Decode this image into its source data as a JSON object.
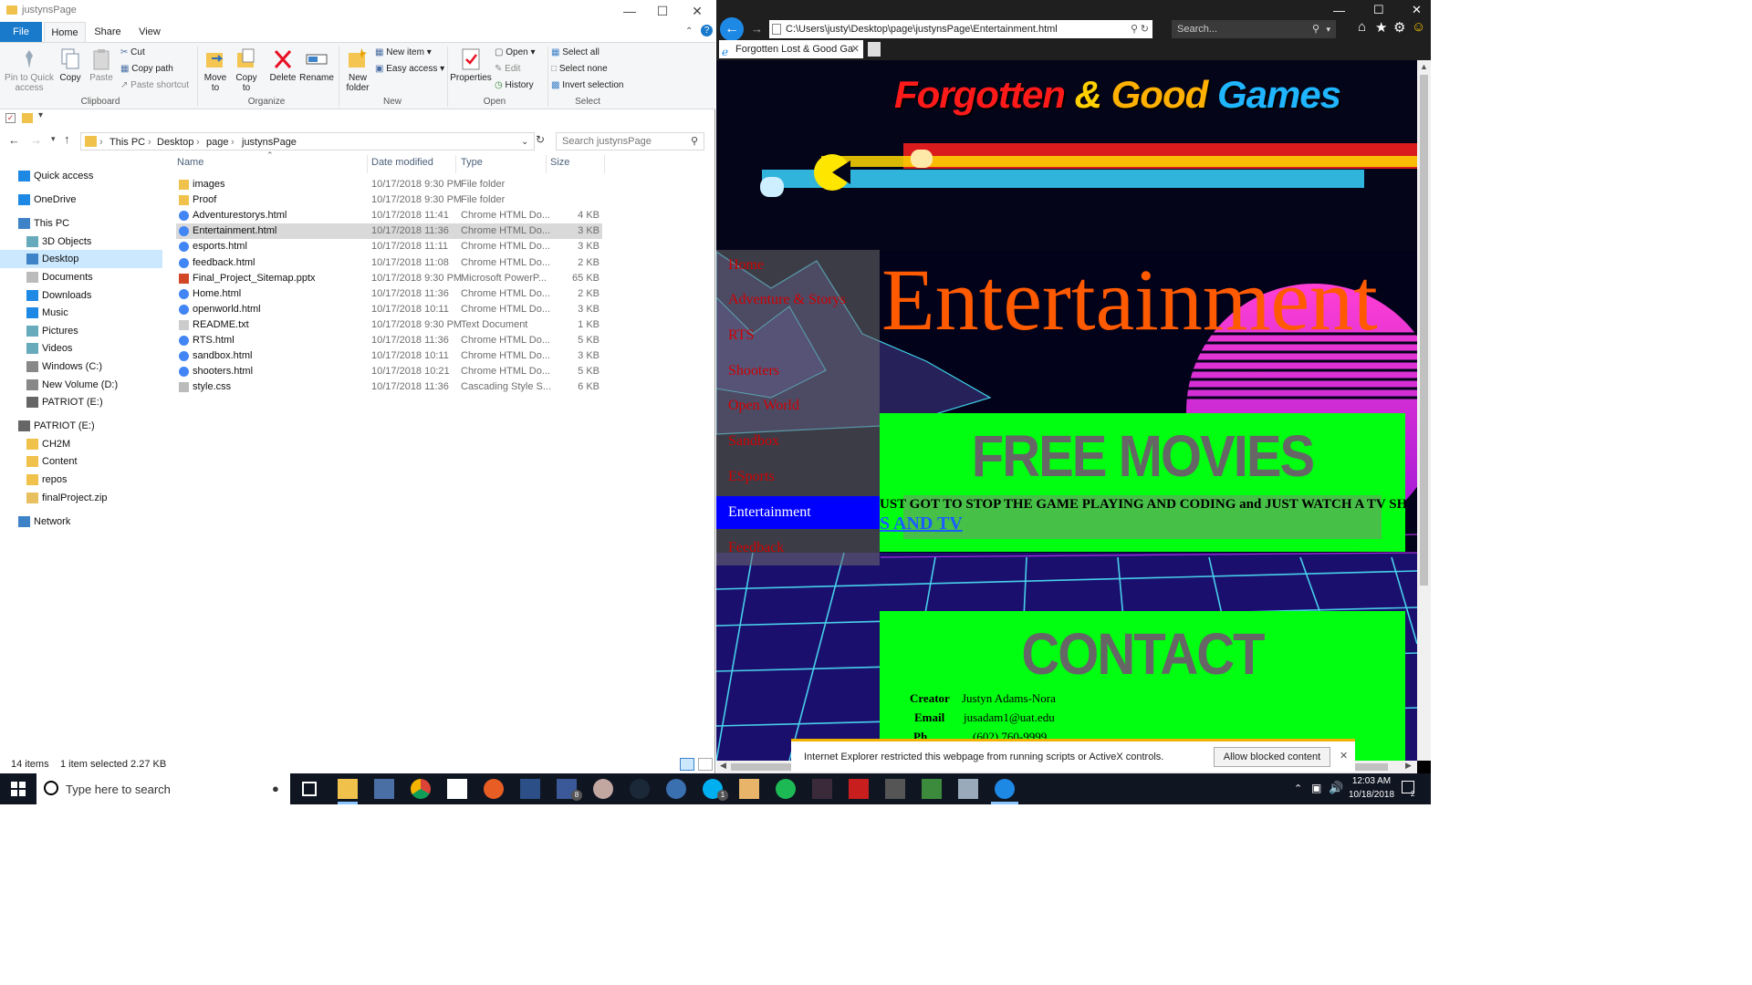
{
  "explorer": {
    "title": "justynsPage",
    "tabs": [
      "File",
      "Home",
      "Share",
      "View"
    ],
    "ribbon": {
      "clipboard": {
        "pin": "Pin to Quick access",
        "copy": "Copy",
        "paste": "Paste",
        "cut": "Cut",
        "copy_path": "Copy path",
        "paste_shortcut": "Paste shortcut",
        "group": "Clipboard"
      },
      "organize": {
        "move": "Move to",
        "copy": "Copy to",
        "delete": "Delete",
        "rename": "Rename",
        "group": "Organize"
      },
      "new": {
        "new_folder": "New folder",
        "new_item": "New item",
        "easy_access": "Easy access",
        "group": "New"
      },
      "open": {
        "properties": "Properties",
        "open": "Open",
        "edit": "Edit",
        "history": "History",
        "group": "Open"
      },
      "select": {
        "select_all": "Select all",
        "select_none": "Select none",
        "invert": "Invert selection",
        "group": "Select"
      }
    },
    "breadcrumb": [
      "This PC",
      "Desktop",
      "page",
      "justynsPage"
    ],
    "search_placeholder": "Search justynsPage",
    "nav": [
      {
        "label": "Quick access",
        "icon": "star-icon",
        "level": 0
      },
      {
        "label": "OneDrive",
        "icon": "cloud-icon",
        "level": 0
      },
      {
        "label": "This PC",
        "icon": "computer-icon",
        "level": 0
      },
      {
        "label": "3D Objects",
        "icon": "cube-icon",
        "level": 1
      },
      {
        "label": "Desktop",
        "icon": "desktop-icon",
        "level": 1,
        "selected": true
      },
      {
        "label": "Documents",
        "icon": "document-icon",
        "level": 1
      },
      {
        "label": "Downloads",
        "icon": "download-icon",
        "level": 1
      },
      {
        "label": "Music",
        "icon": "music-icon",
        "level": 1
      },
      {
        "label": "Pictures",
        "icon": "pictures-icon",
        "level": 1
      },
      {
        "label": "Videos",
        "icon": "video-icon",
        "level": 1
      },
      {
        "label": "Windows (C:)",
        "icon": "drive-icon",
        "level": 1
      },
      {
        "label": "New Volume (D:)",
        "icon": "drive-icon",
        "level": 1
      },
      {
        "label": "PATRIOT (E:)",
        "icon": "usb-drive-icon",
        "level": 1
      },
      {
        "label": "PATRIOT (E:)",
        "icon": "usb-drive-icon",
        "level": 0
      },
      {
        "label": "CH2M",
        "icon": "folder-icon",
        "level": 1
      },
      {
        "label": "Content",
        "icon": "folder-icon",
        "level": 1
      },
      {
        "label": "repos",
        "icon": "folder-icon",
        "level": 1
      },
      {
        "label": "finalProject.zip",
        "icon": "zip-icon",
        "level": 1
      },
      {
        "label": "Network",
        "icon": "network-icon",
        "level": 0
      }
    ],
    "columns": [
      "Name",
      "Date modified",
      "Type",
      "Size"
    ],
    "files": [
      {
        "name": "images",
        "date": "10/17/2018 9:30 PM",
        "type": "File folder",
        "size": "",
        "icon": "folder-icon"
      },
      {
        "name": "Proof",
        "date": "10/17/2018 9:30 PM",
        "type": "File folder",
        "size": "",
        "icon": "folder-icon"
      },
      {
        "name": "Adventurestorys.html",
        "date": "10/17/2018 11:41",
        "type": "Chrome HTML Do...",
        "size": "4 KB",
        "icon": "chrome-icon"
      },
      {
        "name": "Entertainment.html",
        "date": "10/17/2018 11:36",
        "type": "Chrome HTML Do...",
        "size": "3 KB",
        "icon": "chrome-icon",
        "selected": true
      },
      {
        "name": "esports.html",
        "date": "10/17/2018 11:11",
        "type": "Chrome HTML Do...",
        "size": "3 KB",
        "icon": "chrome-icon"
      },
      {
        "name": "feedback.html",
        "date": "10/17/2018 11:08",
        "type": "Chrome HTML Do...",
        "size": "2 KB",
        "icon": "chrome-icon"
      },
      {
        "name": "Final_Project_Sitemap.pptx",
        "date": "10/17/2018 9:30 PM",
        "type": "Microsoft PowerP...",
        "size": "65 KB",
        "icon": "powerpoint-icon"
      },
      {
        "name": "Home.html",
        "date": "10/17/2018 11:36",
        "type": "Chrome HTML Do...",
        "size": "2 KB",
        "icon": "chrome-icon"
      },
      {
        "name": "openworld.html",
        "date": "10/17/2018 10:11",
        "type": "Chrome HTML Do...",
        "size": "3 KB",
        "icon": "chrome-icon"
      },
      {
        "name": "README.txt",
        "date": "10/17/2018 9:30 PM",
        "type": "Text Document",
        "size": "1 KB",
        "icon": "text-file-icon"
      },
      {
        "name": "RTS.html",
        "date": "10/17/2018 11:36",
        "type": "Chrome HTML Do...",
        "size": "5 KB",
        "icon": "chrome-icon"
      },
      {
        "name": "sandbox.html",
        "date": "10/17/2018 10:11",
        "type": "Chrome HTML Do...",
        "size": "3 KB",
        "icon": "chrome-icon"
      },
      {
        "name": "shooters.html",
        "date": "10/17/2018 10:21",
        "type": "Chrome HTML Do...",
        "size": "5 KB",
        "icon": "chrome-icon"
      },
      {
        "name": "style.css",
        "date": "10/17/2018 11:36",
        "type": "Cascading Style S...",
        "size": "6 KB",
        "icon": "css-file-icon"
      }
    ],
    "status": {
      "count": "14 items",
      "selected": "1 item selected  2.27 KB"
    }
  },
  "ie": {
    "address": "C:\\Users\\justy\\Desktop\\page\\justynsPage\\Entertainment.html",
    "search_placeholder": "Search...",
    "tab_title": "Forgotten Lost & Good Ga",
    "page": {
      "logo": {
        "part1": "Forgotten",
        "amp": "&",
        "part2": "Good",
        "part3": "Games"
      },
      "heading": "Entertainment",
      "menu": [
        {
          "label": "Home"
        },
        {
          "label": "Adventure & Storys"
        },
        {
          "label": "RTS"
        },
        {
          "label": "Shooters"
        },
        {
          "label": "Open World"
        },
        {
          "label": "Sandbox"
        },
        {
          "label": "ESports"
        },
        {
          "label": "Entertainment",
          "active": true
        },
        {
          "label": "Feedback"
        }
      ],
      "free_movies": {
        "title": "FREE MOVIES",
        "text": "UST GOT TO STOP THE GAME PLAYING AND CODING and JUST WATCH A TV SH",
        "link": "S AND TV"
      },
      "contact": {
        "title": "CONTACT",
        "rows": [
          {
            "label": "Creator",
            "value": "Justyn Adams-Nora"
          },
          {
            "label": "Email",
            "value": "jusadam1@uat.edu"
          },
          {
            "label": "Ph",
            "value": "(602) 760-9999"
          }
        ]
      }
    },
    "infobar": {
      "message": "Internet Explorer restricted this webpage from running scripts or ActiveX controls.",
      "button": "Allow blocked content"
    }
  },
  "taskbar": {
    "search_placeholder": "Type here to search",
    "time": "12:03 AM",
    "date": "10/18/2018",
    "notification_count": "2",
    "badges": {
      "facebook": "8",
      "skype": "1"
    }
  },
  "colors": {
    "accent": "#0078d7",
    "menu_red": "#d00000",
    "active_blue": "#0000ff",
    "green": "#00ff10",
    "orange": "#ff5a00"
  }
}
